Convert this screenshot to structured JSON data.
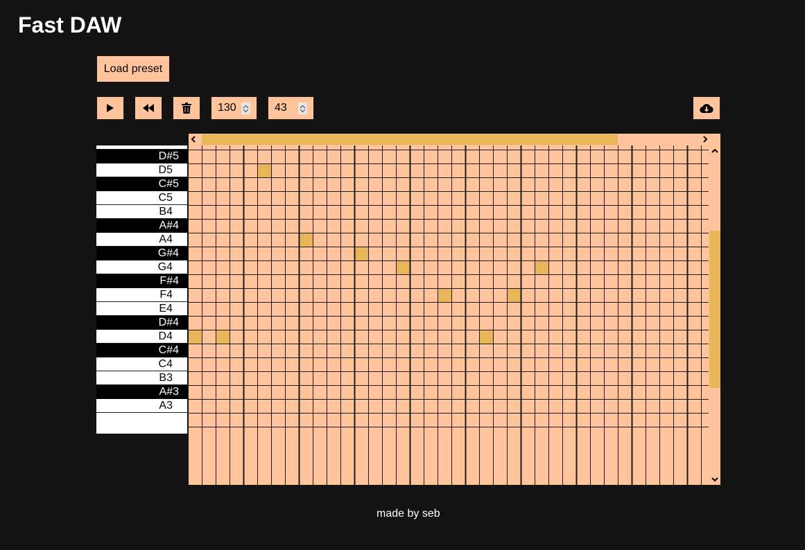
{
  "app": {
    "title": "Fast DAW"
  },
  "toolbar": {
    "load_preset_label": "Load preset",
    "play_icon": "play-icon",
    "rewind_icon": "rewind-icon",
    "trash_icon": "trash-icon",
    "download_icon": "cloud-download-icon",
    "bpm_value": "130",
    "steps_value": "43"
  },
  "piano_roll": {
    "keys": [
      {
        "label": "D#5",
        "type": "black"
      },
      {
        "label": "D5",
        "type": "white"
      },
      {
        "label": "C#5",
        "type": "black"
      },
      {
        "label": "C5",
        "type": "white"
      },
      {
        "label": "B4",
        "type": "white"
      },
      {
        "label": "A#4",
        "type": "black"
      },
      {
        "label": "A4",
        "type": "white"
      },
      {
        "label": "G#4",
        "type": "black"
      },
      {
        "label": "G4",
        "type": "white"
      },
      {
        "label": "F#4",
        "type": "black"
      },
      {
        "label": "F4",
        "type": "white"
      },
      {
        "label": "E4",
        "type": "white"
      },
      {
        "label": "D#4",
        "type": "black"
      },
      {
        "label": "D4",
        "type": "white"
      },
      {
        "label": "C#4",
        "type": "black"
      },
      {
        "label": "C4",
        "type": "white"
      },
      {
        "label": "B3",
        "type": "white"
      },
      {
        "label": "A#3",
        "type": "black"
      },
      {
        "label": "A3",
        "type": "white"
      }
    ],
    "visible_steps": 37,
    "beat_group": 4,
    "active_notes": [
      {
        "note": "D5",
        "step": 5
      },
      {
        "note": "A4",
        "step": 8
      },
      {
        "note": "G#4",
        "step": 12
      },
      {
        "note": "G4",
        "step": 15
      },
      {
        "note": "G4",
        "step": 25
      },
      {
        "note": "F4",
        "step": 18
      },
      {
        "note": "F4",
        "step": 23
      },
      {
        "note": "D4",
        "step": 0
      },
      {
        "note": "D4",
        "step": 2
      },
      {
        "note": "D4",
        "step": 21
      }
    ]
  },
  "colors": {
    "background": "#131313",
    "cell": "#ffc49b",
    "active_cell": "#e8b559",
    "grid_line": "#1a1a1a"
  },
  "footer": {
    "text": "made by seb"
  }
}
